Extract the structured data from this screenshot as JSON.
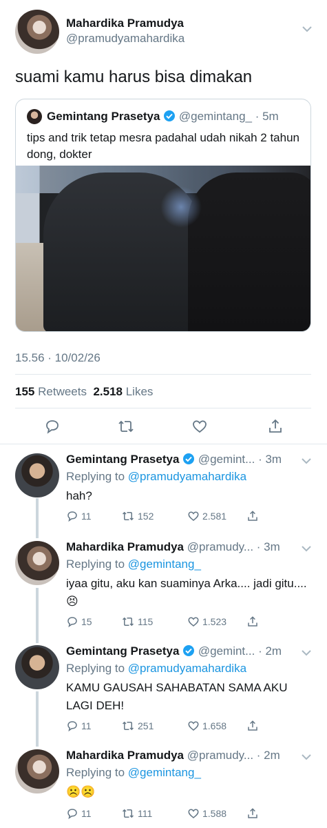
{
  "main_tweet": {
    "name": "Mahardika Pramudya",
    "handle": "@pramudyamahardika",
    "text": "suami kamu harus bisa dimakan",
    "quote": {
      "name": "Gemintang Prasetya",
      "handle": "@gemintang_",
      "time": "· 5m",
      "text": "tips and trik tetap mesra padahal udah nikah 2 tahun dong, dokter"
    },
    "timestamp": "15.56 · 10/02/26",
    "retweets_count": "155",
    "retweets_label": "Retweets",
    "likes_count": "2.518",
    "likes_label": "Likes"
  },
  "replies": [
    {
      "name": "Gemintang Prasetya",
      "handle": "@gemint...",
      "time": "· 3m",
      "replying_label": "Replying to",
      "replying_to": "@pramudyamahardika",
      "text": "hah?",
      "replies": "11",
      "retweets": "152",
      "likes": "2.581"
    },
    {
      "name": "Mahardika Pramudya",
      "handle": "@pramudy...",
      "time": "· 3m",
      "replying_label": "Replying to",
      "replying_to": "@gemintang_",
      "text": "iyaa gitu, aku kan suaminya Arka.... jadi gitu....😣",
      "replies": "15",
      "retweets": "115",
      "likes": "1.523"
    },
    {
      "name": "Gemintang Prasetya",
      "handle": "@gemint...",
      "time": "· 2m",
      "replying_label": "Replying to",
      "replying_to": "@pramudyamahardika",
      "text": "KAMU GAUSAH SAHABATAN SAMA AKU LAGI DEH!",
      "replies": "11",
      "retweets": "251",
      "likes": "1.658"
    },
    {
      "name": "Mahardika Pramudya",
      "handle": "@pramudy...",
      "time": "· 2m",
      "replying_label": "Replying to",
      "replying_to": "@gemintang_",
      "text": "☹️☹️",
      "replies": "11",
      "retweets": "111",
      "likes": "1.588"
    }
  ],
  "colors": {
    "accent": "#1b95e0",
    "secondary_text": "#657786",
    "divider": "#e1e8ed",
    "verified": "#1da1f2"
  },
  "icons": [
    "chevron-down-icon",
    "verified-icon",
    "reply-icon",
    "retweet-icon",
    "like-icon",
    "share-icon"
  ]
}
